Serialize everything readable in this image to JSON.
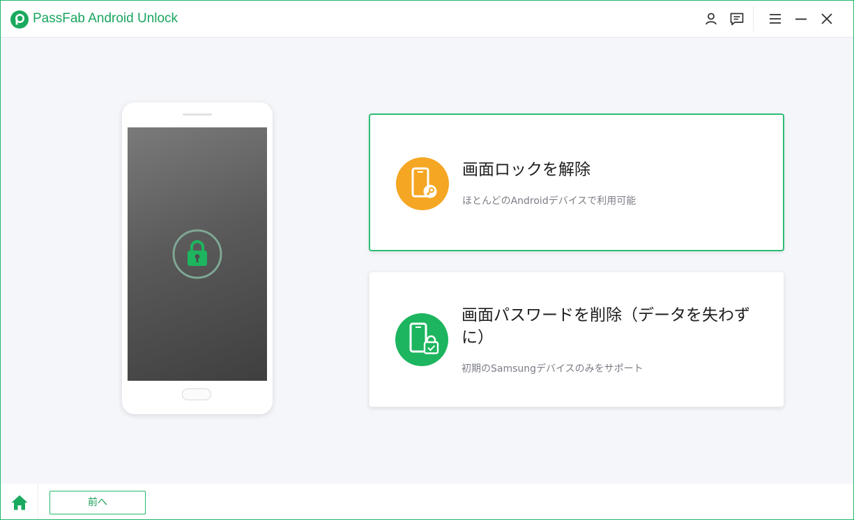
{
  "app": {
    "title": "PassFab Android Unlock",
    "logo_icon": "passfab-logo-icon",
    "accent_color": "#1fb86a"
  },
  "titlebar": {
    "icons": [
      "user-icon",
      "feedback-icon",
      "menu-icon",
      "minimize-icon",
      "close-icon"
    ]
  },
  "phone": {
    "screen_icon": "padlock-icon"
  },
  "options": [
    {
      "title": "画面ロックを解除",
      "description": "ほとんどのAndroidデバイスで利用可能",
      "icon": "phone-key-icon",
      "icon_color": "#f5a623",
      "selected": true
    },
    {
      "title": "画面パスワードを削除（データを失わずに）",
      "description": "初期のSamsungデバイスのみをサポート",
      "icon": "phone-lock-check-icon",
      "icon_color": "#1db55f",
      "selected": false
    }
  ],
  "footer": {
    "home_icon": "home-icon",
    "back_label": "前へ"
  }
}
